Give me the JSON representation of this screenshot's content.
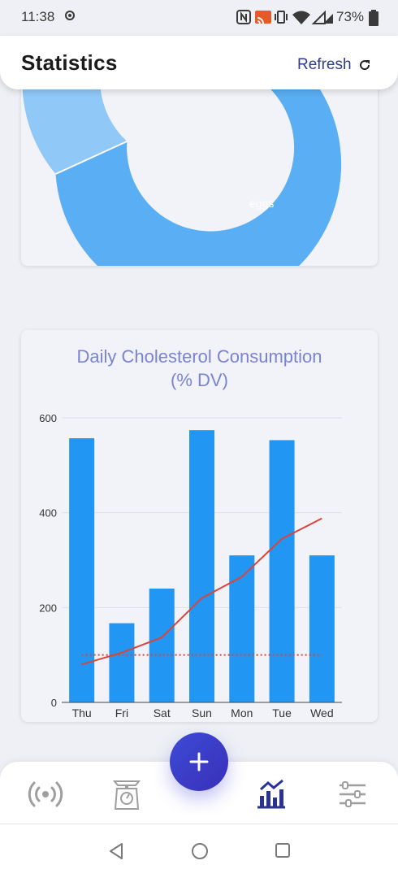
{
  "status_bar": {
    "time": "11:38",
    "battery": "73%"
  },
  "header": {
    "title": "Statistics",
    "refresh_label": "Refresh"
  },
  "colors": {
    "accent": "#2e3d8f",
    "bar": "#2196f3",
    "line": "#d9453b",
    "donut_main": "#5aaef3",
    "donut_secondary": "#90c8f8",
    "title": "#7a83d1"
  },
  "donut_chart": {
    "visible_label": "eggs"
  },
  "chart_data": {
    "type": "bar",
    "title": "Daily Cholesterol Consumption (% DV)",
    "title_lines": [
      "Daily Cholesterol Consumption",
      "(% DV)"
    ],
    "categories": [
      "Thu",
      "Fri",
      "Sat",
      "Sun",
      "Mon",
      "Tue",
      "Wed"
    ],
    "values": [
      557,
      167,
      240,
      574,
      310,
      553,
      310
    ],
    "line_values": [
      80,
      105,
      137,
      220,
      265,
      345,
      388
    ],
    "reference_value": 100,
    "ylim": [
      0,
      600
    ],
    "yticks": [
      0,
      200,
      400,
      600
    ],
    "grid": true,
    "legend": "none"
  },
  "bottom_nav": {
    "items": [
      "broadcast-icon",
      "kitchen-scale-icon",
      "bar-chart-icon",
      "sliders-icon"
    ],
    "active": "bar-chart-icon"
  }
}
